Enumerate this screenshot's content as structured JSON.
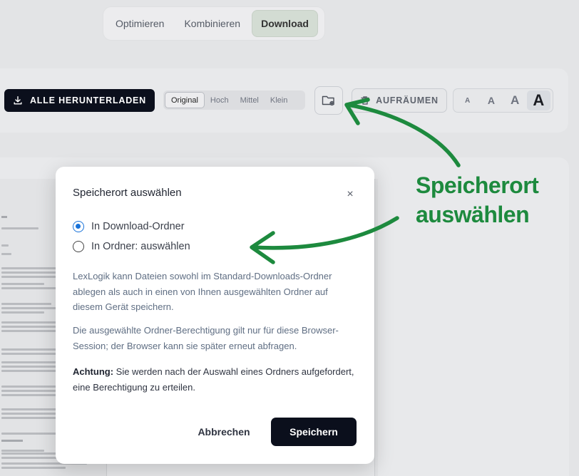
{
  "tabs": [
    {
      "label": "Optimieren",
      "active": false
    },
    {
      "label": "Kombinieren",
      "active": false
    },
    {
      "label": "Download",
      "active": true
    }
  ],
  "toolbar": {
    "download_all_label": "ALLE HERUNTERLADEN",
    "download_icon": "download-icon",
    "size_options": [
      {
        "label": "Original",
        "active": true
      },
      {
        "label": "Hoch",
        "active": false
      },
      {
        "label": "Mittel",
        "active": false
      },
      {
        "label": "Klein",
        "active": false
      }
    ],
    "folder_icon": "folder-settings-icon",
    "cleanup_label": "AUFRÄUMEN",
    "cleanup_icon": "trash-icon",
    "font_sizes": [
      "A",
      "A",
      "A",
      "A"
    ],
    "font_active_index": 3
  },
  "annotation": {
    "line1": "Speicherort",
    "line2": "auswählen",
    "color": "#1d8a3e"
  },
  "modal": {
    "title": "Speicherort auswählen",
    "close_symbol": "×",
    "options": [
      {
        "label": "In Download-Ordner",
        "checked": true
      },
      {
        "label": "In Ordner: auswählen",
        "checked": false
      }
    ],
    "description": "LexLogik kann Dateien sowohl im Standard-Downloads-Ordner ablegen als auch in einen von Ihnen ausgewählten Ordner auf diesem Gerät speichern.",
    "permission_note": "Die ausgewählte Ordner-Berechtigung gilt nur für diese Browser-Session; der Browser kann sie später erneut abfragen.",
    "warning_label": "Achtung:",
    "warning_text": " Sie werden nach der Auswahl eines Ordners aufgefordert, eine Berechtigung zu erteilen.",
    "cancel_label": "Abbrechen",
    "save_label": "Speichern"
  },
  "colors": {
    "accent": "#1872d9",
    "primary_button": "#0b0f1c"
  }
}
